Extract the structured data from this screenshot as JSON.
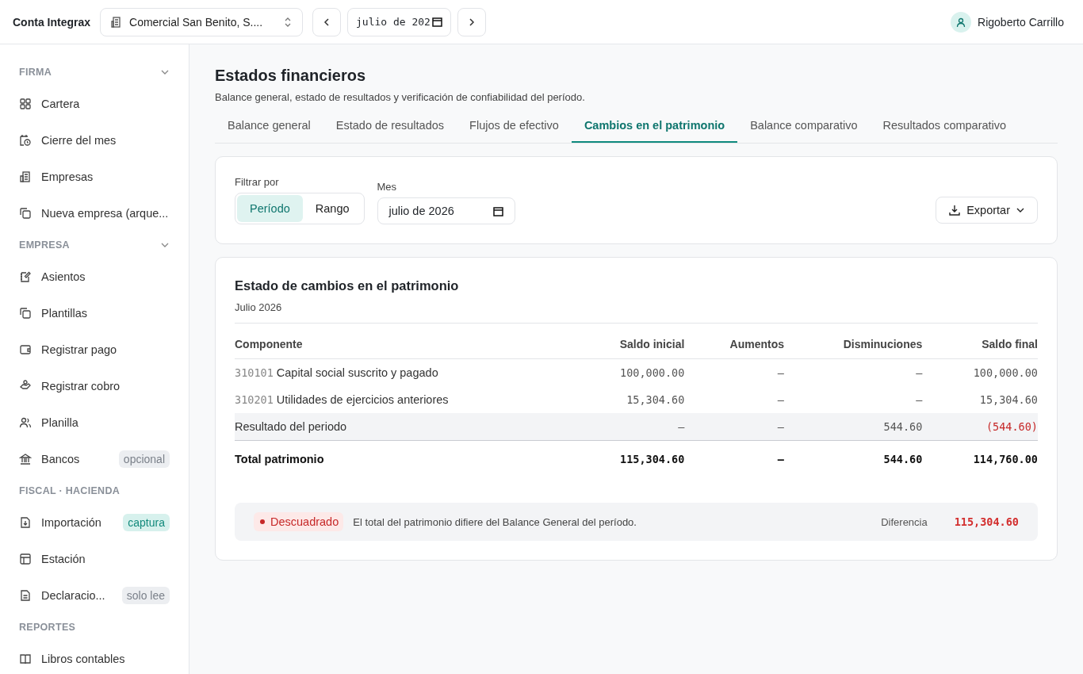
{
  "header": {
    "brand": "Conta Integrax",
    "company": "Comercial San Benito, S....",
    "month": "julio de 202",
    "user": "Rigoberto Carrillo"
  },
  "sidebar": {
    "sections": [
      {
        "title": "FIRMA",
        "collapsible": true,
        "items": [
          {
            "label": "Cartera"
          },
          {
            "label": "Cierre del mes"
          },
          {
            "label": "Empresas"
          },
          {
            "label": "Nueva empresa (arque..."
          }
        ]
      },
      {
        "title": "EMPRESA",
        "collapsible": true,
        "items": [
          {
            "label": "Asientos"
          },
          {
            "label": "Plantillas"
          },
          {
            "label": "Registrar pago"
          },
          {
            "label": "Registrar cobro"
          },
          {
            "label": "Planilla"
          },
          {
            "label": "Bancos",
            "badge": "opcional",
            "badge_accent": false
          }
        ]
      },
      {
        "title": "FISCAL · HACIENDA",
        "collapsible": false,
        "items": [
          {
            "label": "Importación",
            "badge": "captura",
            "badge_accent": true
          },
          {
            "label": "Estación"
          },
          {
            "label": "Declaracio...",
            "badge": "solo lee",
            "badge_accent": false
          }
        ]
      },
      {
        "title": "REPORTES",
        "collapsible": false,
        "items": [
          {
            "label": "Libros contables"
          }
        ]
      }
    ]
  },
  "page": {
    "title": "Estados financieros",
    "subtitle": "Balance general, estado de resultados y verificación de confiabilidad del período."
  },
  "tabs": [
    {
      "label": "Balance general",
      "selected": false
    },
    {
      "label": "Estado de resultados",
      "selected": false
    },
    {
      "label": "Flujos de efectivo",
      "selected": false
    },
    {
      "label": "Cambios en el patrimonio",
      "selected": true
    },
    {
      "label": "Balance comparativo",
      "selected": false
    },
    {
      "label": "Resultados comparativo",
      "selected": false
    }
  ],
  "filter": {
    "label": "Filtrar por",
    "options": [
      {
        "label": "Período",
        "selected": true
      },
      {
        "label": "Rango",
        "selected": false
      }
    ],
    "month_label": "Mes",
    "month": "julio de 2026",
    "export": "Exportar"
  },
  "report": {
    "title": "Estado de cambios en el patrimonio",
    "period": "Julio 2026",
    "columns": [
      "Componente",
      "Saldo inicial",
      "Aumentos",
      "Disminuciones",
      "Saldo final"
    ],
    "rows": [
      {
        "kind": "account",
        "code": "310101",
        "name": "Capital social suscrito y pagado",
        "values": [
          "100,000.00",
          "—",
          "—",
          "100,000.00"
        ],
        "negative": false,
        "highlighted": false
      },
      {
        "kind": "account",
        "code": "310201",
        "name": "Utilidades de ejercicios anteriores",
        "values": [
          "15,304.60",
          "—",
          "—",
          "15,304.60"
        ],
        "negative": false,
        "highlighted": false
      },
      {
        "kind": "result",
        "name": "Resultado del periodo",
        "values": [
          "—",
          "—",
          "544.60",
          "(544.60)"
        ],
        "negative": true,
        "highlighted": true
      },
      {
        "kind": "total",
        "name": "Total patrimonio",
        "values": [
          "115,304.60",
          "—",
          "544.60",
          "114,760.00"
        ],
        "negative": false,
        "highlighted": false
      }
    ],
    "check": {
      "status": "Descuadrado",
      "message": "El total del patrimonio difiere del Balance General del período.",
      "difference_label": "Diferencia",
      "difference": "115,304.60",
      "ok": false
    }
  }
}
